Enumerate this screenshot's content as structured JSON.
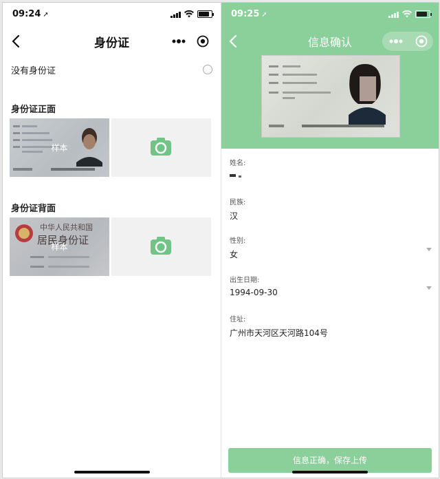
{
  "left": {
    "status_time": "09:24",
    "title": "身份证",
    "no_id_label": "没有身份证",
    "front_section": "身份证正面",
    "back_section": "身份证背面",
    "sample_label": "样本",
    "card_back_heading_1": "中华人民共和国",
    "card_back_heading_2": "居民身份证"
  },
  "right": {
    "status_time": "09:25",
    "title": "信息确认",
    "fields": [
      {
        "label": "姓名:",
        "value": ""
      },
      {
        "label": "民族:",
        "value": "汉"
      },
      {
        "label": "性别:",
        "value": "女"
      },
      {
        "label": "出生日期:",
        "value": "1994-09-30"
      },
      {
        "label": "住址:",
        "value": "广州市天河区天河路104号"
      }
    ],
    "confirm_button": "信息正确，保存上传"
  },
  "colors": {
    "accent_green": "#8bcf9a",
    "camera_green": "#6fc486"
  },
  "icons": {
    "back": "chevron-left-icon",
    "more": "more-dots-icon",
    "close_target": "target-circle-icon",
    "camera": "camera-icon"
  }
}
